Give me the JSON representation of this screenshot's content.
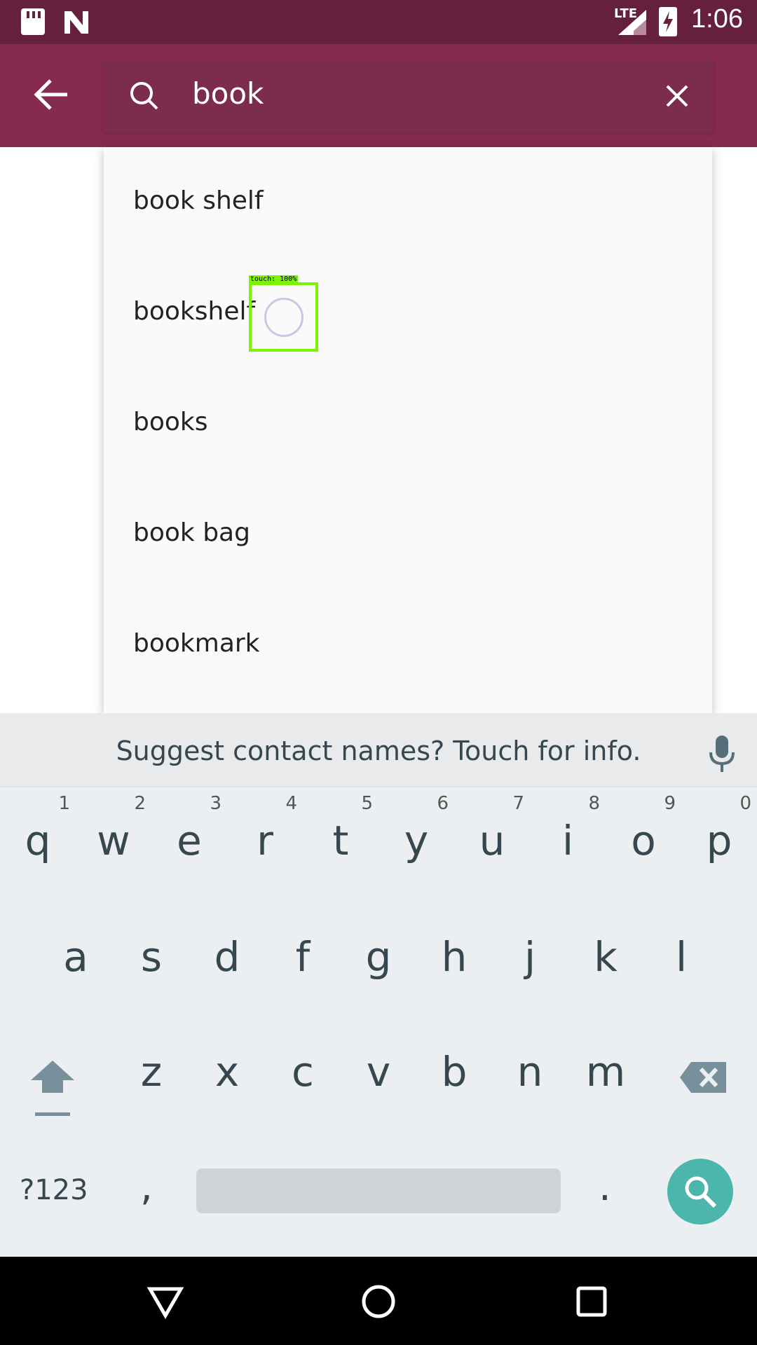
{
  "status_bar": {
    "time": "1:06",
    "network": "LTE"
  },
  "search": {
    "query": "book"
  },
  "suggestions": [
    "book shelf",
    "bookshelf",
    "books",
    "book bag",
    "bookmark"
  ],
  "touch_overlay": {
    "label": "touch: 100%"
  },
  "keyboard": {
    "suggestion_text": "Suggest contact names? Touch for info.",
    "row1": [
      {
        "key": "q",
        "hint": "1"
      },
      {
        "key": "w",
        "hint": "2"
      },
      {
        "key": "e",
        "hint": "3"
      },
      {
        "key": "r",
        "hint": "4"
      },
      {
        "key": "t",
        "hint": "5"
      },
      {
        "key": "y",
        "hint": "6"
      },
      {
        "key": "u",
        "hint": "7"
      },
      {
        "key": "i",
        "hint": "8"
      },
      {
        "key": "o",
        "hint": "9"
      },
      {
        "key": "p",
        "hint": "0"
      }
    ],
    "row2": [
      "a",
      "s",
      "d",
      "f",
      "g",
      "h",
      "j",
      "k",
      "l"
    ],
    "row3": [
      "z",
      "x",
      "c",
      "v",
      "b",
      "n",
      "m"
    ],
    "symbols_label": "?123",
    "comma": ",",
    "period": "."
  },
  "colors": {
    "status_bar": "#65203d",
    "app_bar": "#862a4e",
    "search_key": "#4db6ac",
    "touch_box": "#7af400"
  }
}
